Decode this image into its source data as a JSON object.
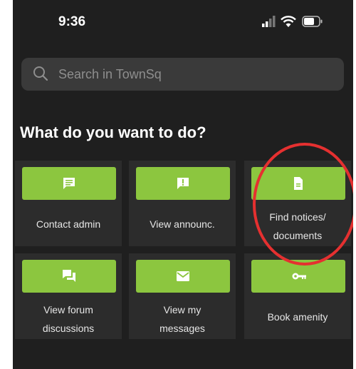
{
  "status_bar": {
    "time": "9:36",
    "signal_icon": "cellular-signal-icon",
    "wifi_icon": "wifi-icon",
    "battery_icon": "battery-icon"
  },
  "search": {
    "placeholder": "Search in TownSq",
    "icon": "search-icon"
  },
  "section_title": "What do you want to do?",
  "accent_color": "#8cc63f",
  "highlight_color": "#e53030",
  "actions": [
    {
      "label_line1": "Contact admin",
      "label_line2": "",
      "icon": "chat-bubble-icon"
    },
    {
      "label_line1": "View announc.",
      "label_line2": "",
      "icon": "announcement-icon"
    },
    {
      "label_line1": "Find notices/",
      "label_line2": "documents",
      "icon": "document-icon"
    },
    {
      "label_line1": "View forum",
      "label_line2": "discussions",
      "icon": "forum-icon"
    },
    {
      "label_line1": "View my",
      "label_line2": "messages",
      "icon": "envelope-icon"
    },
    {
      "label_line1": "Book amenity",
      "label_line2": "",
      "icon": "key-icon"
    }
  ]
}
